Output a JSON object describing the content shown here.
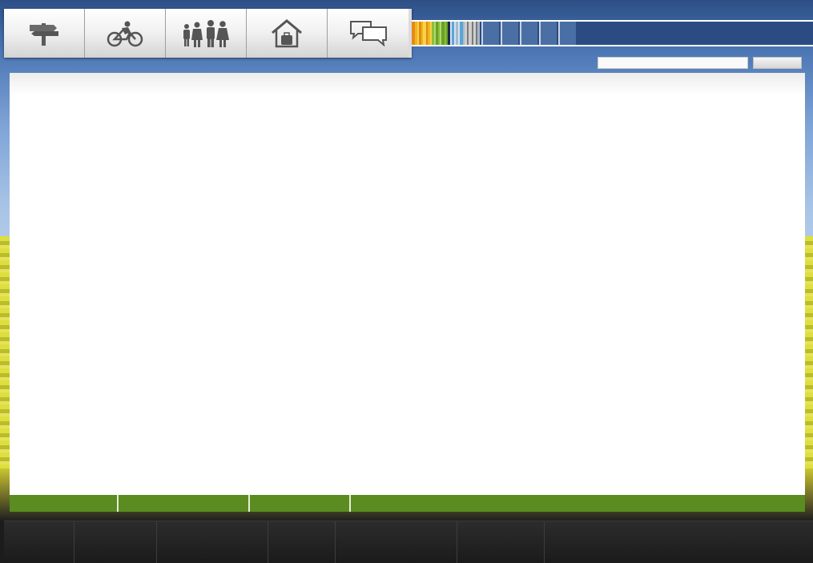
{
  "nav": {
    "items": [
      {
        "icon": "signpost-icon"
      },
      {
        "icon": "cyclist-icon"
      },
      {
        "icon": "family-icon"
      },
      {
        "icon": "house-luggage-icon"
      },
      {
        "icon": "chat-bubbles-icon"
      }
    ]
  },
  "search": {
    "placeholder": "",
    "value": "",
    "button_label": ""
  },
  "colors": {
    "accent_green": "#5a8c21",
    "footer_bg": "#1c1c1c",
    "panel_bg": "#ffffff",
    "stripe_palette": [
      "#f2b51d",
      "#e58a1a",
      "#f5d547",
      "#8cbf3a",
      "#6aa22a",
      "#b4d86a",
      "#1c2a4a",
      "#d0e4f2",
      "#5aa5d8",
      "#a8b8c8",
      "#7a7a7a",
      "#cfcfcf"
    ]
  }
}
